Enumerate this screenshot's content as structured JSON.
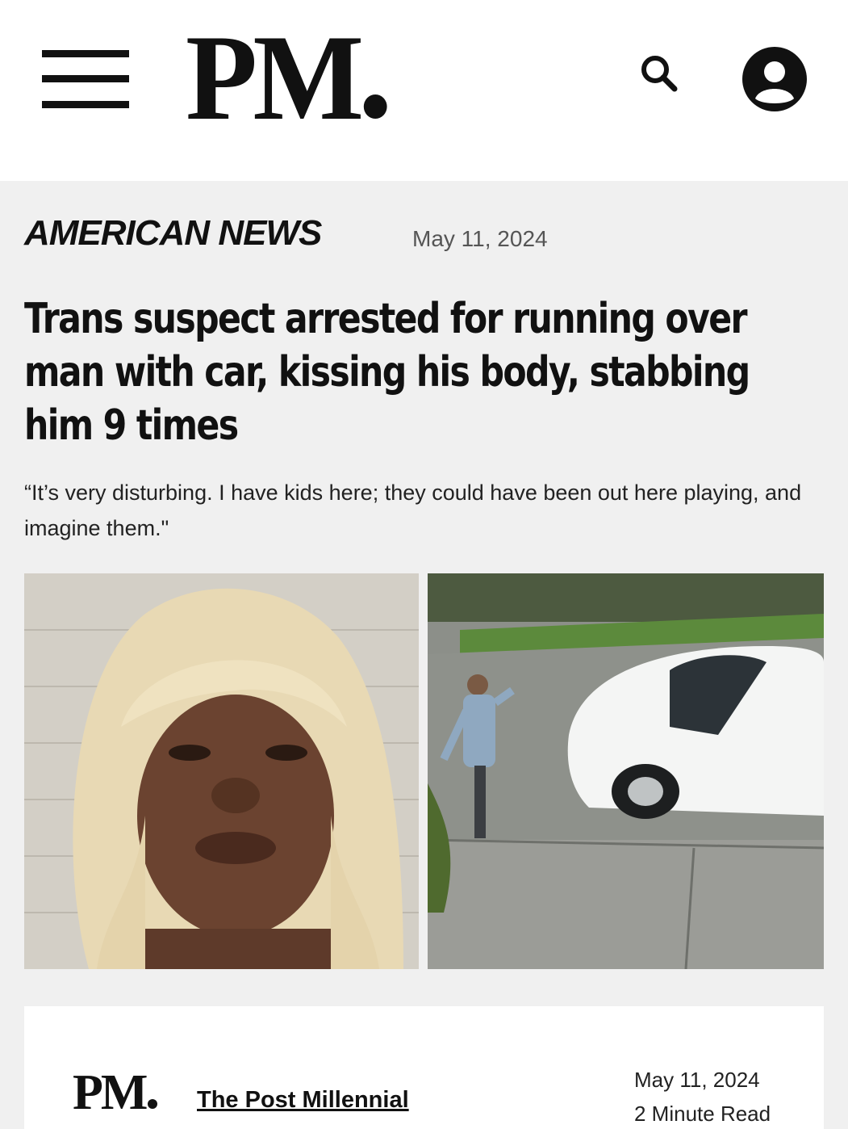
{
  "header": {
    "logo_text": "PM",
    "menu_icon": "hamburger-menu-icon",
    "search_icon": "search-icon",
    "account_icon": "account-icon"
  },
  "article": {
    "section": "AMERICAN NEWS",
    "date": "May 11, 2024",
    "headline": "Trans suspect arrested for running over man with car, kissing his body, stabbing him 9 times",
    "dek": "“It’s very disturbing. I have kids here; they could have been out here playing, and imagine them.\""
  },
  "source_card": {
    "logo_text": "PM",
    "source_name": "The Post Millennial",
    "date": "May 11, 2024",
    "read_time": "2 Minute Read"
  },
  "colors": {
    "page_bg": "#f0f0f0",
    "header_bg": "#ffffff",
    "text": "#111111",
    "date_text": "#555555"
  }
}
